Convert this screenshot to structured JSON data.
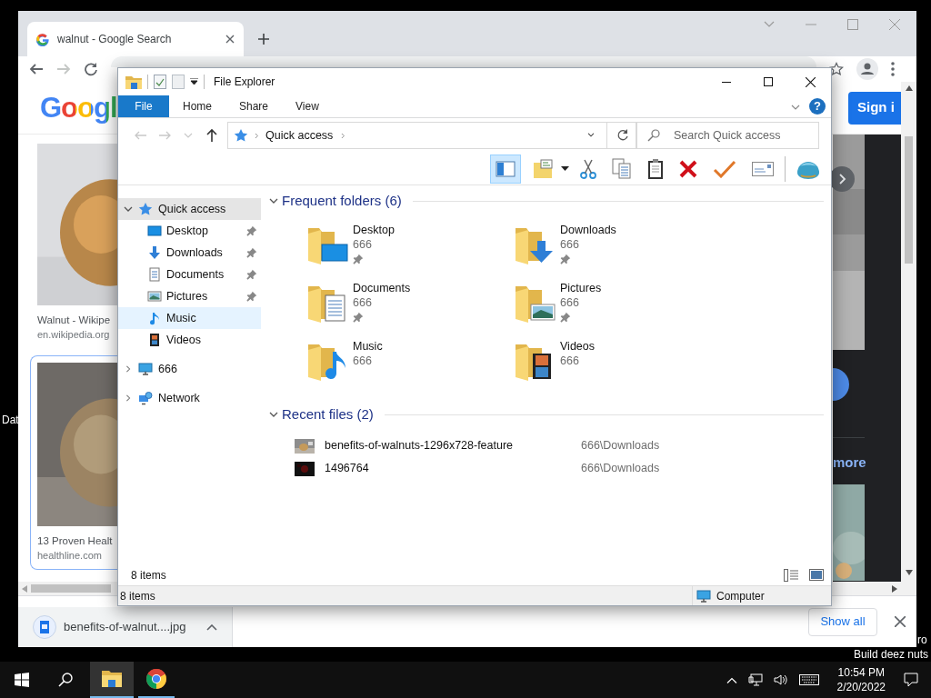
{
  "desktop": {
    "icon_label": "Dat",
    "corner_text": [
      "ro",
      "Build deez nuts"
    ]
  },
  "browser": {
    "tabs": [
      {
        "title": "walnut - Google Search",
        "selected": true
      }
    ],
    "nav": [
      {
        "kind": "back",
        "disabled": false
      },
      {
        "kind": "forward",
        "disabled": true
      },
      {
        "kind": "reload",
        "disabled": false
      }
    ],
    "page": {
      "logo": "Googl",
      "sign_in": "Sign i",
      "results": [
        {
          "title": "Walnut - Wikipe",
          "source": "en.wikipedia.org",
          "selected": false
        },
        {
          "title": "13 Proven Healt",
          "source": "healthline.com",
          "selected": true
        }
      ],
      "side_link": "more"
    },
    "downloads": {
      "items": [
        {
          "name": "benefits-of-walnut....jpg"
        }
      ],
      "show_all": "Show all"
    }
  },
  "explorer": {
    "title": "File Explorer",
    "ribbon_tabs": [
      {
        "label": "File",
        "kind": "file"
      },
      {
        "label": "Home",
        "kind": "tab"
      },
      {
        "label": "Share",
        "kind": "tab"
      },
      {
        "label": "View",
        "kind": "tab"
      }
    ],
    "help": "?",
    "nav_buttons": [
      {
        "kind": "back",
        "disabled": true
      },
      {
        "kind": "forward",
        "disabled": true
      },
      {
        "kind": "recent",
        "disabled": true
      },
      {
        "kind": "up",
        "disabled": false
      }
    ],
    "breadcrumb": [
      "Quick access"
    ],
    "search": {
      "placeholder": "Search Quick access"
    },
    "tools": [
      {
        "kind": "preview",
        "on": true
      },
      {
        "kind": "note"
      },
      {
        "kind": "caret"
      },
      {
        "kind": "cut"
      },
      {
        "kind": "copy"
      },
      {
        "kind": "paste"
      },
      {
        "kind": "delete"
      },
      {
        "kind": "check"
      },
      {
        "kind": "mail"
      },
      {
        "kind": "separator"
      },
      {
        "kind": "globe"
      }
    ],
    "nav_pane": [
      {
        "label": "Quick access",
        "kind": "star",
        "expanded": true,
        "selected": true,
        "hovered": false,
        "children": [
          {
            "label": "Desktop",
            "kind": "desktop",
            "pinned": true,
            "selected": false,
            "hovered": false
          },
          {
            "label": "Downloads",
            "kind": "downloads",
            "pinned": true,
            "selected": false,
            "hovered": false
          },
          {
            "label": "Documents",
            "kind": "documents",
            "pinned": true,
            "selected": false,
            "hovered": false
          },
          {
            "label": "Pictures",
            "kind": "pictures",
            "pinned": true,
            "selected": false,
            "hovered": false
          },
          {
            "label": "Music",
            "kind": "music",
            "pinned": false,
            "selected": false,
            "hovered": true
          },
          {
            "label": "Videos",
            "kind": "videos",
            "pinned": false,
            "selected": false,
            "hovered": false
          }
        ]
      },
      {
        "label": "666",
        "kind": "computer",
        "expanded": false,
        "selected": false,
        "hovered": false
      },
      {
        "label": "Network",
        "kind": "network",
        "expanded": false,
        "selected": false,
        "hovered": false
      }
    ],
    "sections": [
      {
        "heading": "Frequent folders (6)",
        "kind": "folders",
        "expanded": true,
        "items": [
          {
            "name": "Desktop",
            "location": "666",
            "pinned": true,
            "kind": "desktop"
          },
          {
            "name": "Downloads",
            "location": "666",
            "pinned": true,
            "kind": "downloads"
          },
          {
            "name": "Documents",
            "location": "666",
            "pinned": true,
            "kind": "documents"
          },
          {
            "name": "Pictures",
            "location": "666",
            "pinned": true,
            "kind": "pictures"
          },
          {
            "name": "Music",
            "location": "666",
            "pinned": false,
            "kind": "music"
          },
          {
            "name": "Videos",
            "location": "666",
            "pinned": false,
            "kind": "videos"
          }
        ]
      },
      {
        "heading": "Recent files (2)",
        "kind": "files",
        "expanded": true,
        "items": [
          {
            "name": "benefits-of-walnuts-1296x728-feature",
            "location": "666\\Downloads"
          },
          {
            "name": "1496764",
            "location": "666\\Downloads"
          }
        ]
      }
    ],
    "item_count": "8 items",
    "status_bar": {
      "count": "8 items",
      "location": "Computer"
    }
  },
  "taskbar": {
    "apps": [
      {
        "kind": "explorer",
        "active": true
      },
      {
        "kind": "chrome",
        "active": false
      }
    ],
    "time": "10:54 PM",
    "date": "2/20/2022"
  }
}
